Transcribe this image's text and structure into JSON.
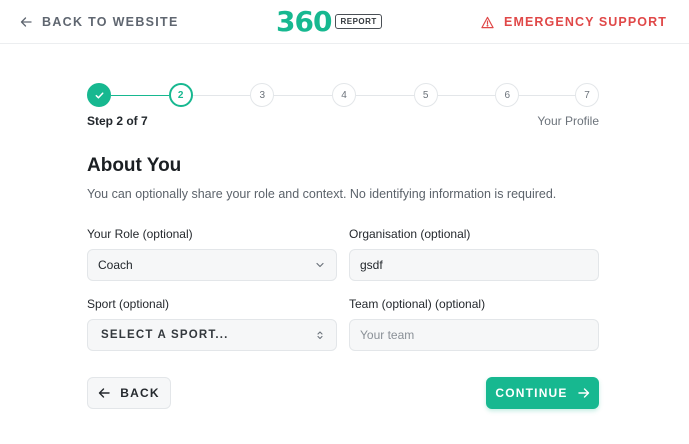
{
  "header": {
    "back_label": "BACK TO WEBSITE",
    "logo_number": "360",
    "logo_badge": "REPORT",
    "emergency_label": "EMERGENCY SUPPORT"
  },
  "stepper": {
    "current": 2,
    "total": 7,
    "steps": [
      "",
      "2",
      "3",
      "4",
      "5",
      "6",
      "7"
    ],
    "step_label": "Step 2 of 7",
    "step_title": "Your Profile"
  },
  "form": {
    "title": "About You",
    "description": "You can optionally share your role and context. No identifying information is required.",
    "role": {
      "label": "Your Role (optional)",
      "value": "Coach"
    },
    "organisation": {
      "label": "Organisation (optional)",
      "value": "gsdf"
    },
    "sport": {
      "label": "Sport (optional)",
      "value": "SELECT A SPORT..."
    },
    "team": {
      "label": "Team (optional) (optional)",
      "value": "",
      "placeholder": "Your team"
    }
  },
  "actions": {
    "back_label": "BACK",
    "continue_label": "CONTINUE"
  },
  "colors": {
    "accent": "#17b890",
    "danger": "#e04848"
  }
}
